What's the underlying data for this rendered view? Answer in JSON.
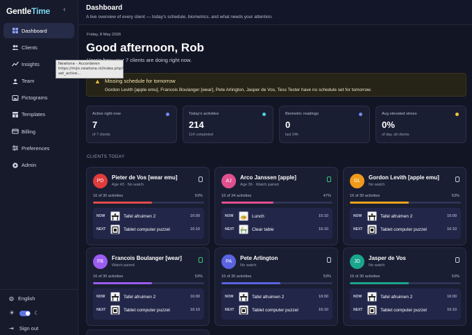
{
  "app": {
    "brand_main": "Gentle",
    "brand_accent": "Time",
    "collapse_icon": "chevron-left-icon"
  },
  "sidebar": {
    "items": [
      {
        "label": "Dashboard",
        "icon": "grid-icon",
        "active": true
      },
      {
        "label": "Clients",
        "icon": "users-icon"
      },
      {
        "label": "Insights",
        "icon": "trend-icon"
      },
      {
        "label": "Team",
        "icon": "team-icon"
      },
      {
        "label": "Pictograms",
        "icon": "image-icon"
      },
      {
        "label": "Templates",
        "icon": "template-icon"
      },
      {
        "label": "Billing",
        "icon": "card-icon"
      },
      {
        "label": "Preferences",
        "icon": "sliders-icon"
      },
      {
        "label": "Admin",
        "icon": "admin-icon"
      }
    ],
    "language": "English",
    "signout": "Sign out"
  },
  "tooltip": {
    "line1": "Newtone - Accorderen",
    "line2": "https://mijn.newtone.nl/index.php?",
    "line3": "set_active..."
  },
  "header": {
    "title": "Dashboard",
    "subtitle": "A live overview of every client — today's schedule, biometrics, and what needs your attention."
  },
  "main": {
    "date": "Friday, 8 May 2026",
    "greeting": "Good afternoon, Rob",
    "summary": "Here's how your 7 clients are doing right now.",
    "alert": {
      "title": "Missing schedule for tomorrow",
      "body": "Gordon Levith [apple emu], Francois Boulanger [wear], Pete Arlington, Jasper de Vos, Tess Tester have no schedule set for tomorrow."
    },
    "stats": [
      {
        "label": "Active right now",
        "value": "7",
        "sub": "of 7 clients",
        "dot_color": "#6f8cf0"
      },
      {
        "label": "Today's activities",
        "value": "214",
        "sub": "114 completed",
        "dot_color": "#4fd0e0"
      },
      {
        "label": "Biometric readings",
        "value": "0",
        "sub": "last 24h",
        "dot_color": "#6f8cf0"
      },
      {
        "label": "Avg elevated stress",
        "value": "0%",
        "sub": "of day, all clients",
        "dot_color": "#f0c33c"
      }
    ],
    "section_label": "CLIENTS TODAY"
  },
  "clients": [
    {
      "initials": "PD",
      "name": "Pieter de Vos [wear emu]",
      "meta": "Age 43 · No watch",
      "avatar_color": "#e03c3c",
      "watch_on": false,
      "progress": "16 of 30 activities",
      "pct": "53%",
      "fill": 0.53,
      "bar_color": "#e24b4b",
      "now_label": "NOW",
      "now": "Tafel afruimen 2",
      "now_time": "16:00",
      "now_icon": "table-icon",
      "next_label": "NEXT",
      "next": "Tablet computer puzzel",
      "next_time": "16:10",
      "next_icon": "tablet-icon"
    },
    {
      "initials": "AJ",
      "name": "Arco Janssen [apple]",
      "meta": "Age 36 · Watch paired",
      "avatar_color": "#e0508f",
      "watch_on": true,
      "progress": "16 of 34 activities",
      "pct": "47%",
      "fill": 0.47,
      "bar_color": "#e0508f",
      "now_label": "NOW",
      "now": "Lunch",
      "now_time": "15:10",
      "now_icon": "lunch-icon",
      "next_label": "NEXT",
      "next": "Clear table",
      "next_time": "16:10",
      "next_icon": "clear-table-icon"
    },
    {
      "initials": "GL",
      "name": "Gordon Levith [apple emu]",
      "meta": "No watch",
      "avatar_color": "#f09a1a",
      "watch_on": false,
      "progress": "16 of 30 activities",
      "pct": "53%",
      "fill": 0.53,
      "bar_color": "#f0a21a",
      "now_label": "NOW",
      "now": "Tafel afruimen 2",
      "now_time": "16:00",
      "now_icon": "table-icon",
      "next_label": "NEXT",
      "next": "Tablet computer puzzel",
      "next_time": "16:10",
      "next_icon": "tablet-icon"
    },
    {
      "initials": "FB",
      "name": "Francois Boulanger [wear]",
      "meta": "Watch paired",
      "avatar_color": "#9b5cf0",
      "watch_on": true,
      "progress": "16 of 30 activities",
      "pct": "53%",
      "fill": 0.53,
      "bar_color": "#9b5cf0",
      "now_label": "NOW",
      "now": "Tafel afruimen 2",
      "now_time": "16:00",
      "now_icon": "table-icon",
      "next_label": "NEXT",
      "next": "Tablet computer puzzel",
      "next_time": "16:10",
      "next_icon": "tablet-icon"
    },
    {
      "initials": "PA",
      "name": "Pete Arlington",
      "meta": "No watch",
      "avatar_color": "#5a63e0",
      "watch_on": false,
      "progress": "16 of 30 activities",
      "pct": "53%",
      "fill": 0.53,
      "bar_color": "#5a63e0",
      "now_label": "NOW",
      "now": "Tafel afruimen 2",
      "now_time": "16:00",
      "now_icon": "table-icon",
      "next_label": "NEXT",
      "next": "Tablet computer puzzel",
      "next_time": "16:10",
      "next_icon": "tablet-icon"
    },
    {
      "initials": "JD",
      "name": "Jasper de Vos",
      "meta": "No watch",
      "avatar_color": "#1aa58f",
      "watch_on": false,
      "progress": "16 of 30 activities",
      "pct": "53%",
      "fill": 0.53,
      "bar_color": "#1aa58f",
      "now_label": "NOW",
      "now": "Tafel afruimen 2",
      "now_time": "16:00",
      "now_icon": "table-icon",
      "next_label": "NEXT",
      "next": "Tablet computer puzzel",
      "next_time": "16:10",
      "next_icon": "tablet-icon"
    }
  ]
}
